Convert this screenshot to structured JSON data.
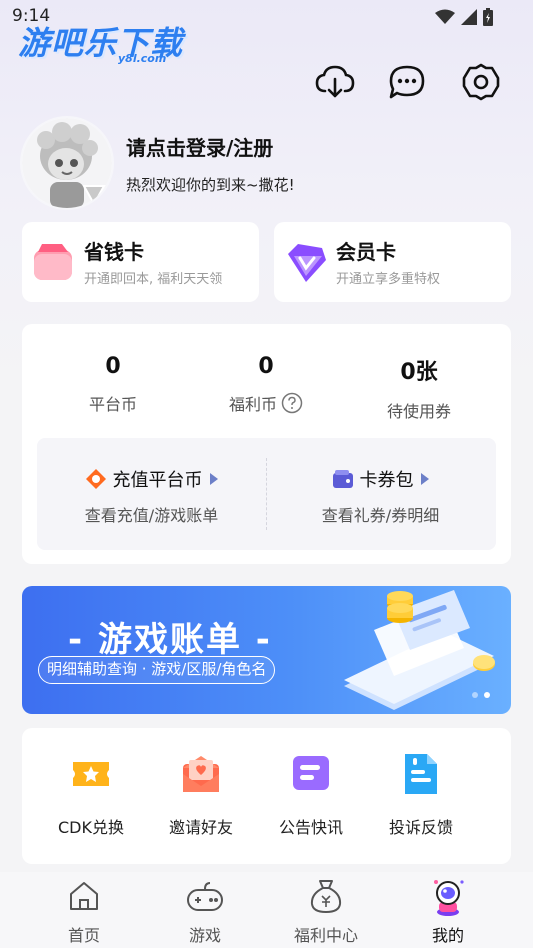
{
  "status_bar": {
    "time": "9:14"
  },
  "watermark": {
    "text": "游吧乐下载",
    "sub": "y8l.com"
  },
  "top_actions": [
    {
      "icon": "cloud-download-icon"
    },
    {
      "icon": "message-icon"
    },
    {
      "icon": "settings-gear-icon"
    }
  ],
  "profile": {
    "login_text": "请点击登录/注册",
    "welcome": "热烈欢迎你的到来~撒花!"
  },
  "cards": {
    "save": {
      "title": "省钱卡",
      "subtitle": "开通即回本, 福利天天领"
    },
    "vip": {
      "title": "会员卡",
      "subtitle": "开通立享多重特权"
    }
  },
  "wallet": {
    "stats": [
      {
        "value": "0",
        "label": "平台币"
      },
      {
        "value": "0",
        "label": "福利币"
      },
      {
        "value": "0张",
        "label": "待使用券"
      }
    ],
    "recharge": {
      "title": "充值平台币",
      "subtitle": "查看充值/游戏账单"
    },
    "coupon": {
      "title": "卡券包",
      "subtitle": "查看礼券/券明细"
    }
  },
  "banner": {
    "title": "- 游戏账单 -",
    "subtitle": "明细辅助查询 · 游戏/区服/角色名",
    "page_index": 2,
    "page_count": 2
  },
  "tools": [
    {
      "label": "CDK兑换",
      "icon": "cdk-ticket-icon"
    },
    {
      "label": "邀请好友",
      "icon": "invite-envelope-icon"
    },
    {
      "label": "公告快讯",
      "icon": "announcement-icon"
    },
    {
      "label": "投诉反馈",
      "icon": "feedback-document-icon"
    }
  ],
  "tabbar": [
    {
      "label": "首页",
      "icon": "home-icon"
    },
    {
      "label": "游戏",
      "icon": "gamepad-icon"
    },
    {
      "label": "福利中心",
      "icon": "money-bag-icon"
    },
    {
      "label": "我的",
      "icon": "profile-astronaut-icon",
      "active": true
    }
  ],
  "colors": {
    "accent_blue": "#3d6ff0",
    "orange": "#ff6a1f",
    "vip_purple": "#8a4dff",
    "pink": "#ff6b8b"
  }
}
